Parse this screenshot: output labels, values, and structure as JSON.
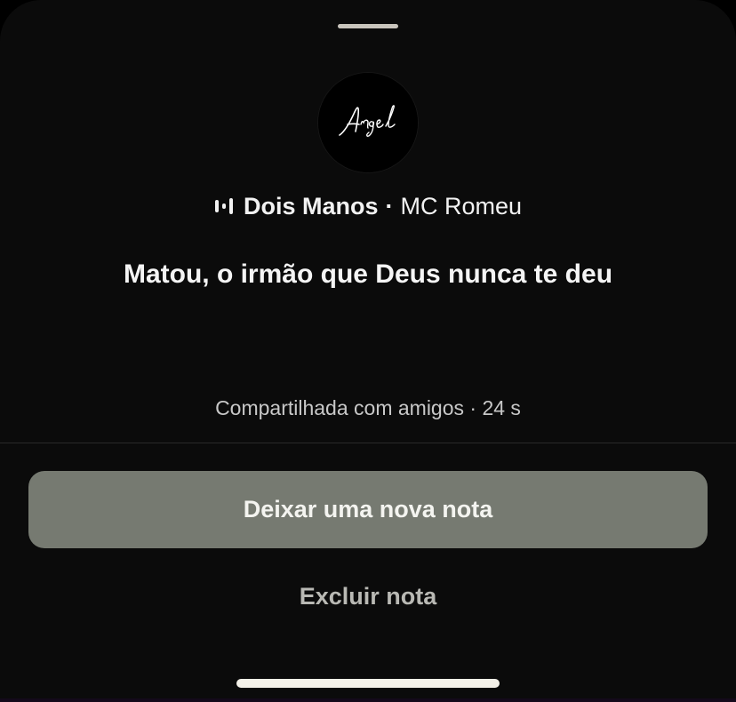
{
  "sheet": {
    "avatar_logo_text": "Angel",
    "song": {
      "icon": "audio-bars-icon",
      "title": "Dois Manos",
      "separator": "·",
      "artist": "MC Romeu"
    },
    "note_text": "Matou, o irmão que Deus nunca te deu",
    "shared_meta": "Compartilhada com amigos · 24 s",
    "primary_button_label": "Deixar uma nova nota",
    "secondary_button_label": "Excluir nota"
  },
  "colors": {
    "background": "#0b0b0b",
    "primary_button": "#767a71",
    "secondary_text": "#b9b9b4"
  }
}
